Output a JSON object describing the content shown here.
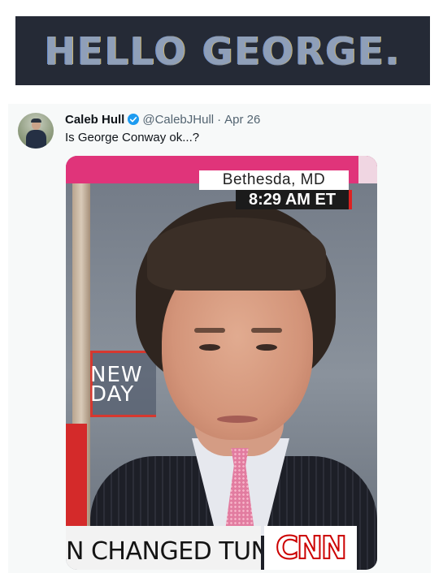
{
  "banner": {
    "text": "HELLO GEORGE."
  },
  "tweet": {
    "author_name": "Caleb Hull",
    "handle": "@CalebJHull",
    "separator": "·",
    "date": "Apr 26",
    "text": "Is George Conway ok...?",
    "verified_color": "#1d9bf0"
  },
  "media": {
    "location": "Bethesda, MD",
    "time": "8:29 AM ET",
    "show_logo": "NEW DAY",
    "chyron": "N CHANGED TUNE",
    "network_logo": "CNN",
    "accent_color": "#cc0000"
  }
}
